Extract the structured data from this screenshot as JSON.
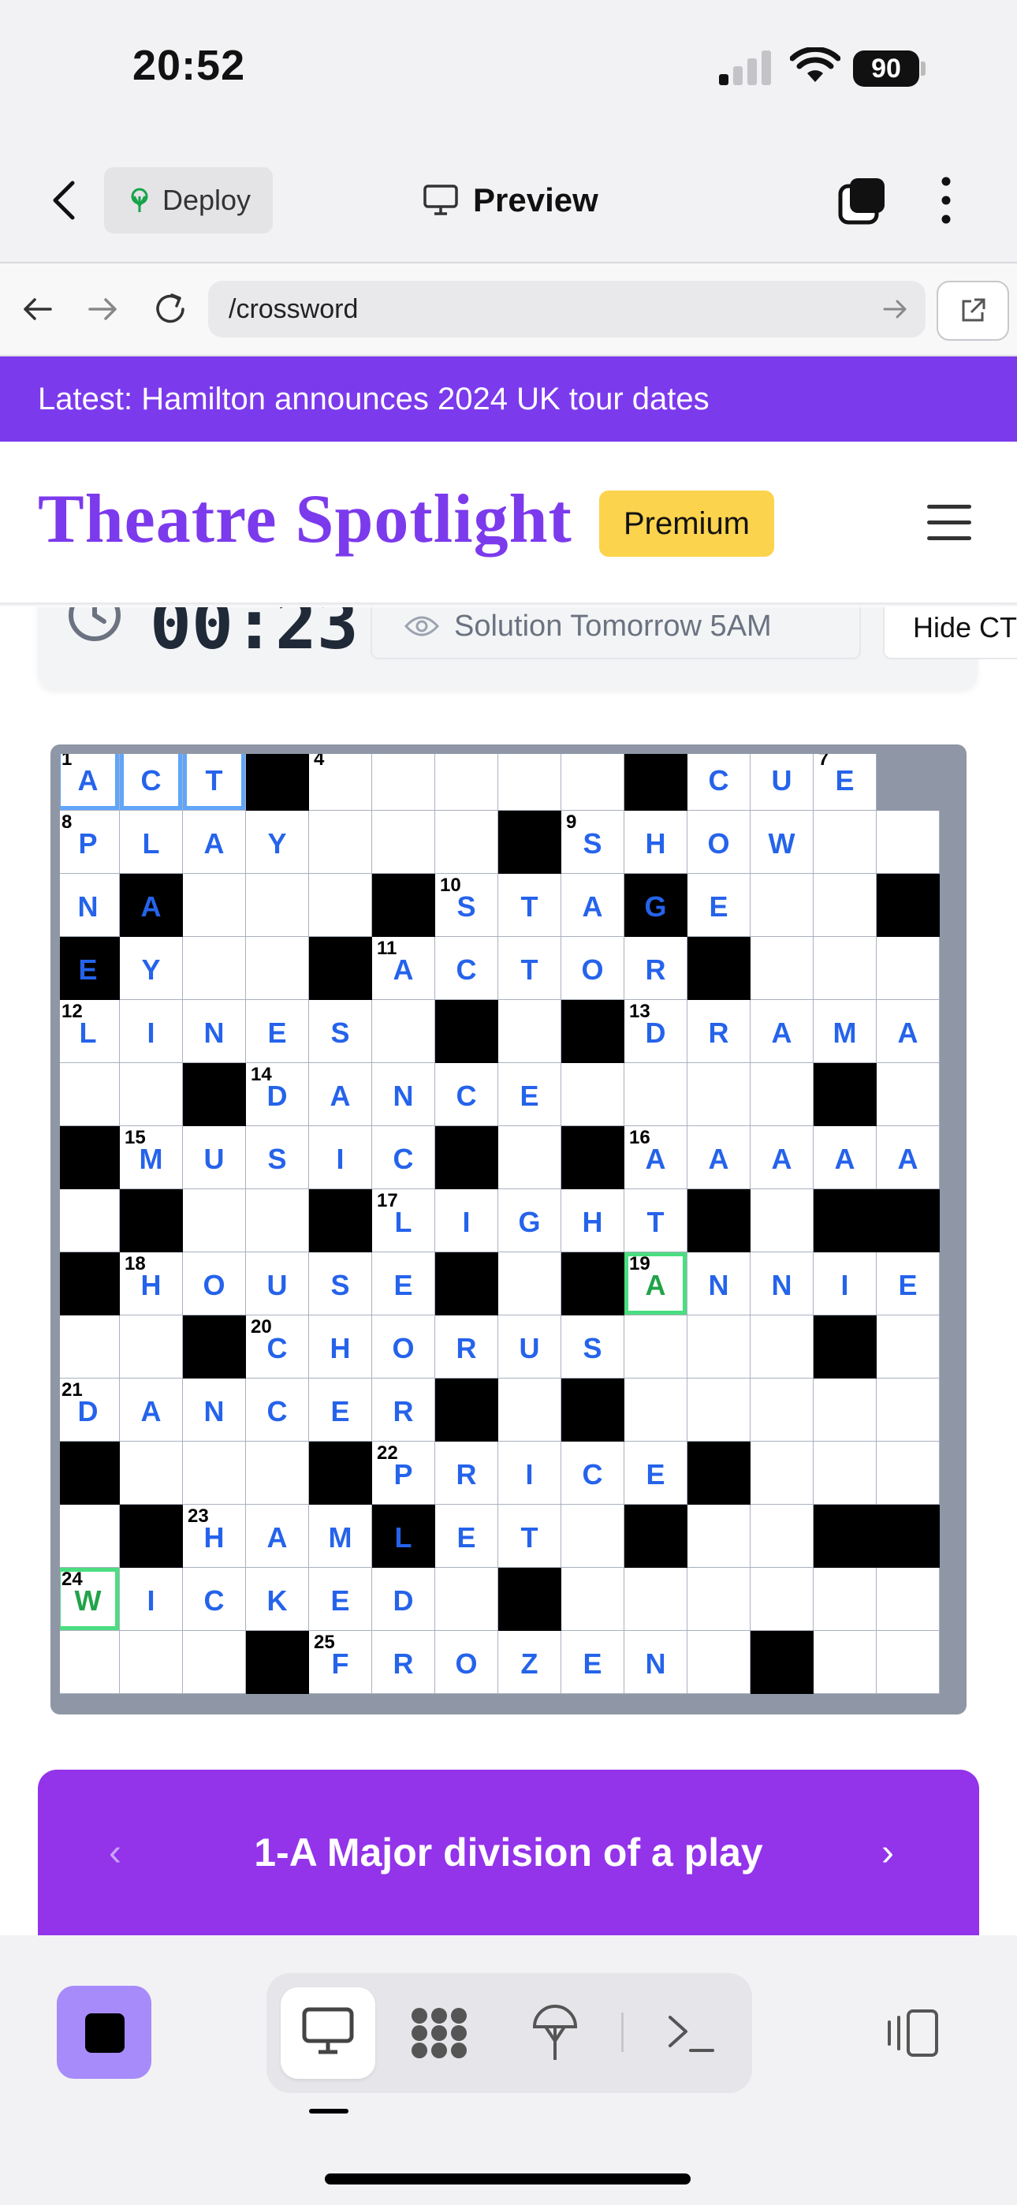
{
  "status_bar": {
    "time": "20:52",
    "battery": "90"
  },
  "app_header": {
    "deploy_label": "Deploy",
    "preview_label": "Preview"
  },
  "browser": {
    "url": "/crossword"
  },
  "news_banner": {
    "text": "Latest: Hamilton announces 2024 UK tour dates"
  },
  "site": {
    "title": "Theatre Spotlight",
    "premium_label": "Premium"
  },
  "timer": {
    "time": "00:23",
    "solution_label": "Solution Tomorrow 5AM",
    "hide_label": "Hide CT"
  },
  "clue": {
    "text": "1-A Major division of a play",
    "prev": "‹",
    "next": "›"
  },
  "crossword": {
    "rows": [
      "ACT#.....#CUE",
      "PLAY...#SHOW..",
      "NA...#STAGE..#",
      "#Y..#ACTOR#...",
      "LINES.#.#DRAMA",
      "..#DANCE....#.",
      "#MUSIC#.#AAAAA",
      ".#..#LIGHT#..#",
      "#HOUSE#.#ANNIE",
      "..#CHORUS...#.",
      "DANCER#.#.....",
      "#...#PRICE#...",
      ".#HAMLET.#...#",
      "WICKED.#......",
      "...#FROZEN.#.."
    ],
    "numbers": [
      {
        "r": 0,
        "c": 0,
        "n": "1"
      },
      {
        "r": 0,
        "c": 4,
        "n": "4"
      },
      {
        "r": 0,
        "c": 12,
        "n": "7"
      },
      {
        "r": 1,
        "c": 0,
        "n": "8"
      },
      {
        "r": 1,
        "c": 8,
        "n": "9"
      },
      {
        "r": 2,
        "c": 6,
        "n": "10"
      },
      {
        "r": 3,
        "c": 5,
        "n": "11"
      },
      {
        "r": 4,
        "c": 0,
        "n": "12"
      },
      {
        "r": 4,
        "c": 9,
        "n": "13"
      },
      {
        "r": 5,
        "c": 3,
        "n": "14"
      },
      {
        "r": 6,
        "c": 1,
        "n": "15"
      },
      {
        "r": 6,
        "c": 9,
        "n": "16"
      },
      {
        "r": 7,
        "c": 5,
        "n": "17"
      },
      {
        "r": 8,
        "c": 1,
        "n": "18"
      },
      {
        "r": 8,
        "c": 9,
        "n": "19"
      },
      {
        "r": 9,
        "c": 3,
        "n": "20"
      },
      {
        "r": 10,
        "c": 0,
        "n": "21"
      },
      {
        "r": 11,
        "c": 5,
        "n": "22"
      },
      {
        "r": 12,
        "c": 2,
        "n": "23"
      },
      {
        "r": 13,
        "c": 0,
        "n": "24"
      },
      {
        "r": 14,
        "c": 4,
        "n": "25"
      }
    ],
    "selected_word": [
      {
        "r": 0,
        "c": 0
      },
      {
        "r": 0,
        "c": 1
      },
      {
        "r": 0,
        "c": 2
      }
    ],
    "green_cells": [
      {
        "r": 8,
        "c": 9
      },
      {
        "r": 13,
        "c": 0
      }
    ],
    "extra_black": [
      {
        "r": 7,
        "c": 12
      },
      {
        "r": 12,
        "c": 12
      },
      {
        "r": 6,
        "c": 14
      },
      {
        "r": 8,
        "c": 14
      },
      {
        "r": 11,
        "c": 14
      },
      {
        "r": 3,
        "c": 14
      }
    ],
    "extra_letters": [
      {
        "r": 12,
        "c": 5,
        "ch": "L",
        "black": true
      },
      {
        "r": 2,
        "c": 9,
        "ch": "G",
        "black": true
      },
      {
        "r": 2,
        "c": 1,
        "ch": "A",
        "black": true
      },
      {
        "r": 3,
        "c": 0,
        "ch": "E",
        "black": true
      }
    ]
  }
}
